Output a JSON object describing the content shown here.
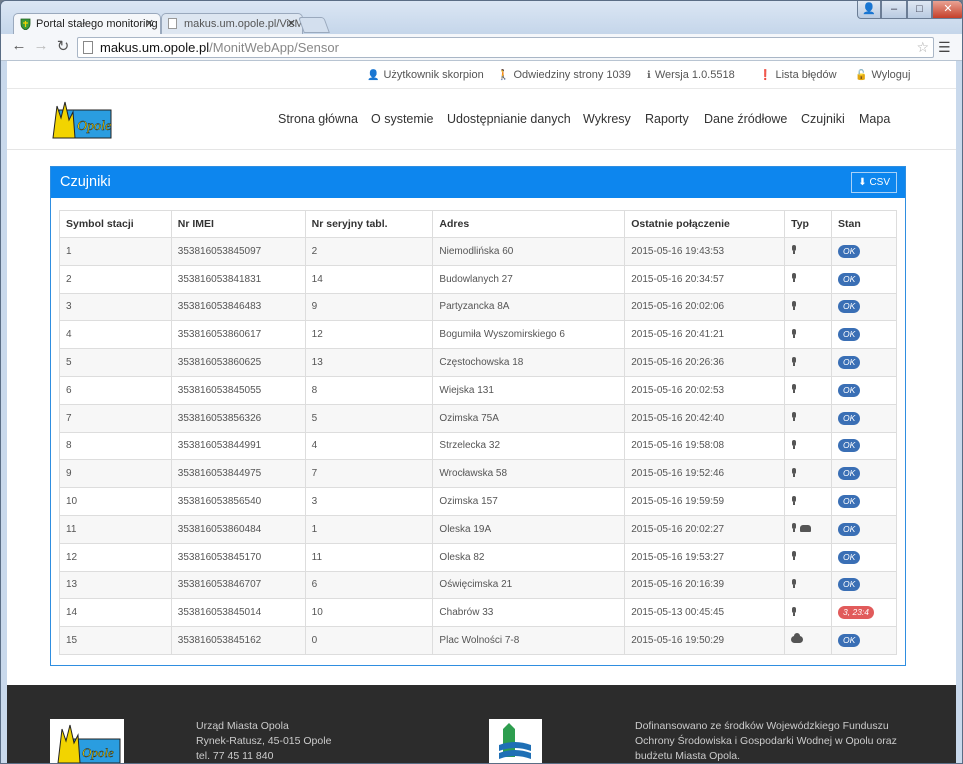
{
  "browser": {
    "tabs": [
      {
        "label": "Portal stałego monitoring"
      },
      {
        "label": "makus.um.opole.pl/VisMa"
      }
    ],
    "url_host": "makus.um.opole.pl",
    "url_path": "/MonitWebApp/Sensor"
  },
  "topbar": {
    "user": "Użytkownik skorpion",
    "visits": "Odwiedziny strony 1039",
    "version": "Wersja 1.0.5518",
    "errors": "Lista błędów",
    "logout": "Wyloguj"
  },
  "logo_text": "Opole",
  "nav": [
    "Strona główna",
    "O systemie",
    "Udostępnianie danych",
    "Wykresy",
    "Raporty",
    "Dane źródłowe",
    "Czujniki",
    "Mapa"
  ],
  "panel": {
    "title": "Czujniki",
    "csv_label": "CSV"
  },
  "table": {
    "headers": [
      "Symbol stacji",
      "Nr IMEI",
      "Nr seryjny tabl.",
      "Adres",
      "Ostatnie połączenie",
      "Typ",
      "Stan"
    ],
    "rows": [
      {
        "symbol": "1",
        "imei": "353816053845097",
        "serial": "2",
        "address": "Niemodlińska 60",
        "last": "2015-05-16 19:43:53",
        "type": "mic",
        "status": "OK"
      },
      {
        "symbol": "2",
        "imei": "353816053841831",
        "serial": "14",
        "address": "Budowlanych 27",
        "last": "2015-05-16 20:34:57",
        "type": "mic",
        "status": "OK"
      },
      {
        "symbol": "3",
        "imei": "353816053846483",
        "serial": "9",
        "address": "Partyzancka 8A",
        "last": "2015-05-16 20:02:06",
        "type": "mic",
        "status": "OK"
      },
      {
        "symbol": "4",
        "imei": "353816053860617",
        "serial": "12",
        "address": "Bogumiła Wyszomirskiego 6",
        "last": "2015-05-16 20:41:21",
        "type": "mic",
        "status": "OK"
      },
      {
        "symbol": "5",
        "imei": "353816053860625",
        "serial": "13",
        "address": "Częstochowska 18",
        "last": "2015-05-16 20:26:36",
        "type": "mic",
        "status": "OK"
      },
      {
        "symbol": "6",
        "imei": "353816053845055",
        "serial": "8",
        "address": "Wiejska 131",
        "last": "2015-05-16 20:02:53",
        "type": "mic",
        "status": "OK"
      },
      {
        "symbol": "7",
        "imei": "353816053856326",
        "serial": "5",
        "address": "Ozimska 75A",
        "last": "2015-05-16 20:42:40",
        "type": "mic",
        "status": "OK"
      },
      {
        "symbol": "8",
        "imei": "353816053844991",
        "serial": "4",
        "address": "Strzelecka 32",
        "last": "2015-05-16 19:58:08",
        "type": "mic",
        "status": "OK"
      },
      {
        "symbol": "9",
        "imei": "353816053844975",
        "serial": "7",
        "address": "Wrocławska 58",
        "last": "2015-05-16 19:52:46",
        "type": "mic",
        "status": "OK"
      },
      {
        "symbol": "10",
        "imei": "353816053856540",
        "serial": "3",
        "address": "Ozimska 157",
        "last": "2015-05-16 19:59:59",
        "type": "mic",
        "status": "OK"
      },
      {
        "symbol": "11",
        "imei": "353816053860484",
        "serial": "1",
        "address": "Oleska 19A",
        "last": "2015-05-16 20:02:27",
        "type": "mic-car",
        "status": "OK"
      },
      {
        "symbol": "12",
        "imei": "353816053845170",
        "serial": "11",
        "address": "Oleska 82",
        "last": "2015-05-16 19:53:27",
        "type": "mic",
        "status": "OK"
      },
      {
        "symbol": "13",
        "imei": "353816053846707",
        "serial": "6",
        "address": "Oświęcimska 21",
        "last": "2015-05-16 20:16:39",
        "type": "mic",
        "status": "OK"
      },
      {
        "symbol": "14",
        "imei": "353816053845014",
        "serial": "10",
        "address": "Chabrów 33",
        "last": "2015-05-13 00:45:45",
        "type": "mic",
        "status": "3, 23:4"
      },
      {
        "symbol": "15",
        "imei": "353816053845162",
        "serial": "0",
        "address": "Plac Wolności 7-8",
        "last": "2015-05-16 19:50:29",
        "type": "cloud",
        "status": "OK"
      }
    ]
  },
  "colors": {
    "panel_header": "#0d86ee",
    "status_ok": "#3a6fb5",
    "status_error": "#e15b5b",
    "footer": "#2c2c2c"
  },
  "footer": {
    "address_lines": [
      "Urząd Miasta Opola",
      "Rynek-Ratusz, 45-015 Opole",
      "tel. 77 45 11 840"
    ],
    "funding_lines": [
      "Dofinansowano ze środków Wojewódzkiego Funduszu",
      "Ochrony Środowiska i Gospodarki Wodnej w Opolu oraz",
      "budżetu Miasta Opola."
    ]
  }
}
